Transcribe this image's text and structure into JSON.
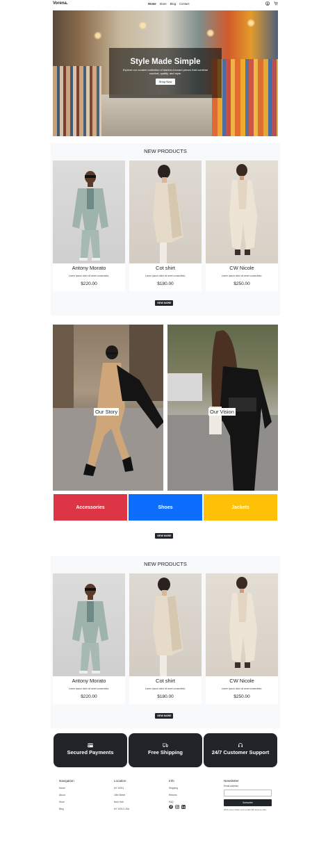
{
  "header": {
    "brand": "Vorena.",
    "nav": [
      "Home",
      "Store",
      "Blog",
      "Contact"
    ]
  },
  "hero": {
    "title": "Style Made Simple",
    "subtitle": "Explore our curated collection of fashion-forward pieces that combine comfort, quality, and style.",
    "button": "Shop Now"
  },
  "products_1": {
    "title": "NEW PRODUCTS",
    "items": [
      {
        "name": "Antony Morato",
        "desc": "Lorem ipsum dolor sit amet consectetur.",
        "price": "$220.00"
      },
      {
        "name": "Cot shirt",
        "desc": "Lorem ipsum dolor sit amet consectetur.",
        "price": "$180.00"
      },
      {
        "name": "CW Nicole",
        "desc": "Lorem ipsum dolor sit amet consectetur.",
        "price": "$250.00"
      }
    ],
    "view_more": "VIEW MORE"
  },
  "story": {
    "left_label": "Our Story",
    "right_label": "Our Vision",
    "categories": [
      {
        "label": "Accessories",
        "color": "#dc3545"
      },
      {
        "label": "Shoes",
        "color": "#0d6efd"
      },
      {
        "label": "Jackets",
        "color": "#ffc107"
      }
    ],
    "view_more": "VIEW MORE"
  },
  "products_2": {
    "title": "NEW PRODUCTS",
    "items": [
      {
        "name": "Antony Morato",
        "desc": "Lorem ipsum dolor sit amet consectetur.",
        "price": "$220.00"
      },
      {
        "name": "Cot shirt",
        "desc": "Lorem ipsum dolor sit amet consectetur.",
        "price": "$180.00"
      },
      {
        "name": "CW Nicole",
        "desc": "Lorem ipsum dolor sit amet consectetur.",
        "price": "$250.00"
      }
    ],
    "view_more": "VIEW MORE"
  },
  "features": [
    {
      "label": "Secured Payments",
      "icon": "credit-card-icon"
    },
    {
      "label": "Free Shipping",
      "icon": "truck-icon"
    },
    {
      "label": "24/7 Customer Support",
      "icon": "headset-icon"
    }
  ],
  "footer": {
    "navigation": {
      "title": "Navigation",
      "items": [
        "Home",
        "About",
        "Store",
        "Blog"
      ]
    },
    "location": {
      "title": "Location",
      "items": [
        "NY 10011",
        "15th Street",
        "New York",
        "NY 10011 USA"
      ]
    },
    "info": {
      "title": "Info",
      "items": [
        "Shipping",
        "Returns",
        "FAQ"
      ]
    },
    "newsletter": {
      "title": "Newsletter",
      "label": "Email address",
      "input_value": "",
      "button": "Subscribe",
      "note": "We'll never share your email with anyone else."
    }
  }
}
